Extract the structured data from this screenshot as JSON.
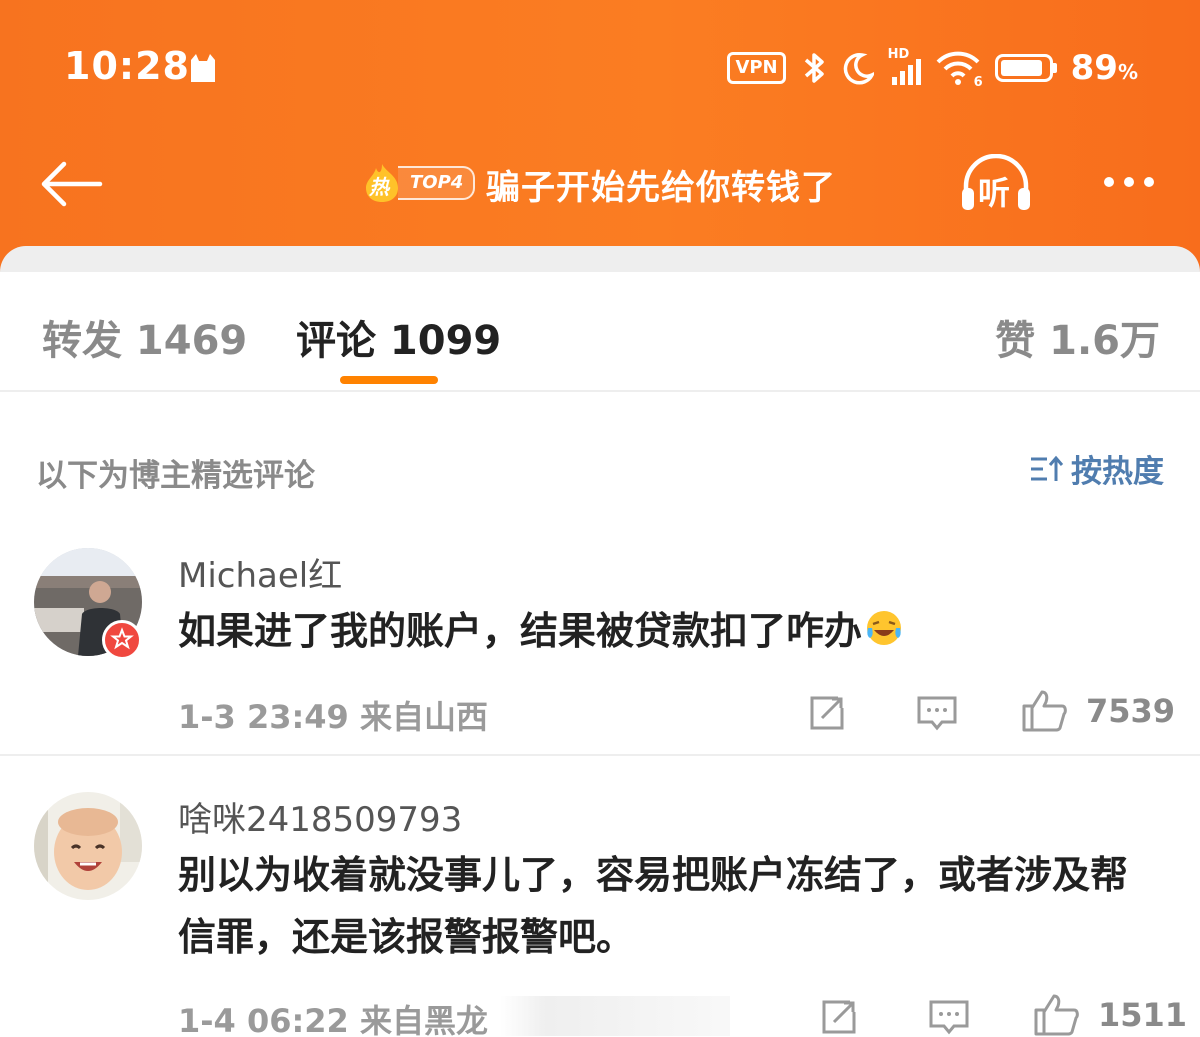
{
  "status_bar": {
    "time": "10:28",
    "vpn_label": "VPN",
    "battery_percent": "89",
    "battery_unit": "%",
    "battery_level": 0.89,
    "signal_label": "HD",
    "wifi_label": "6"
  },
  "nav": {
    "hot_label": "热",
    "hot_rank": "TOP4",
    "title": "骗子开始先给你转钱了",
    "listen_label": "听"
  },
  "tabs": [
    {
      "label": "转发 1469"
    },
    {
      "label": "评论 1099"
    },
    {
      "label": "赞 1.6万"
    }
  ],
  "section": {
    "title": "以下为博主精选评论",
    "sort_label": "按热度"
  },
  "comments": [
    {
      "username": "Michael红",
      "text": "如果进了我的账户，结果被贷款扣了咋办",
      "time_location": "1-3 23:49  来自山西",
      "likes": "7539"
    },
    {
      "username": "啥咪2418509793",
      "text": "别以为收着就没事儿了，容易把账户冻结了，或者涉及帮信罪，还是该报警报警吧。",
      "time_location": "1-4 06:22  来自黑龙",
      "likes": "1511"
    }
  ],
  "colors": {
    "header_orange": "#f7731f",
    "accent_underline": "#ff8200",
    "sort_blue": "#507daf"
  }
}
